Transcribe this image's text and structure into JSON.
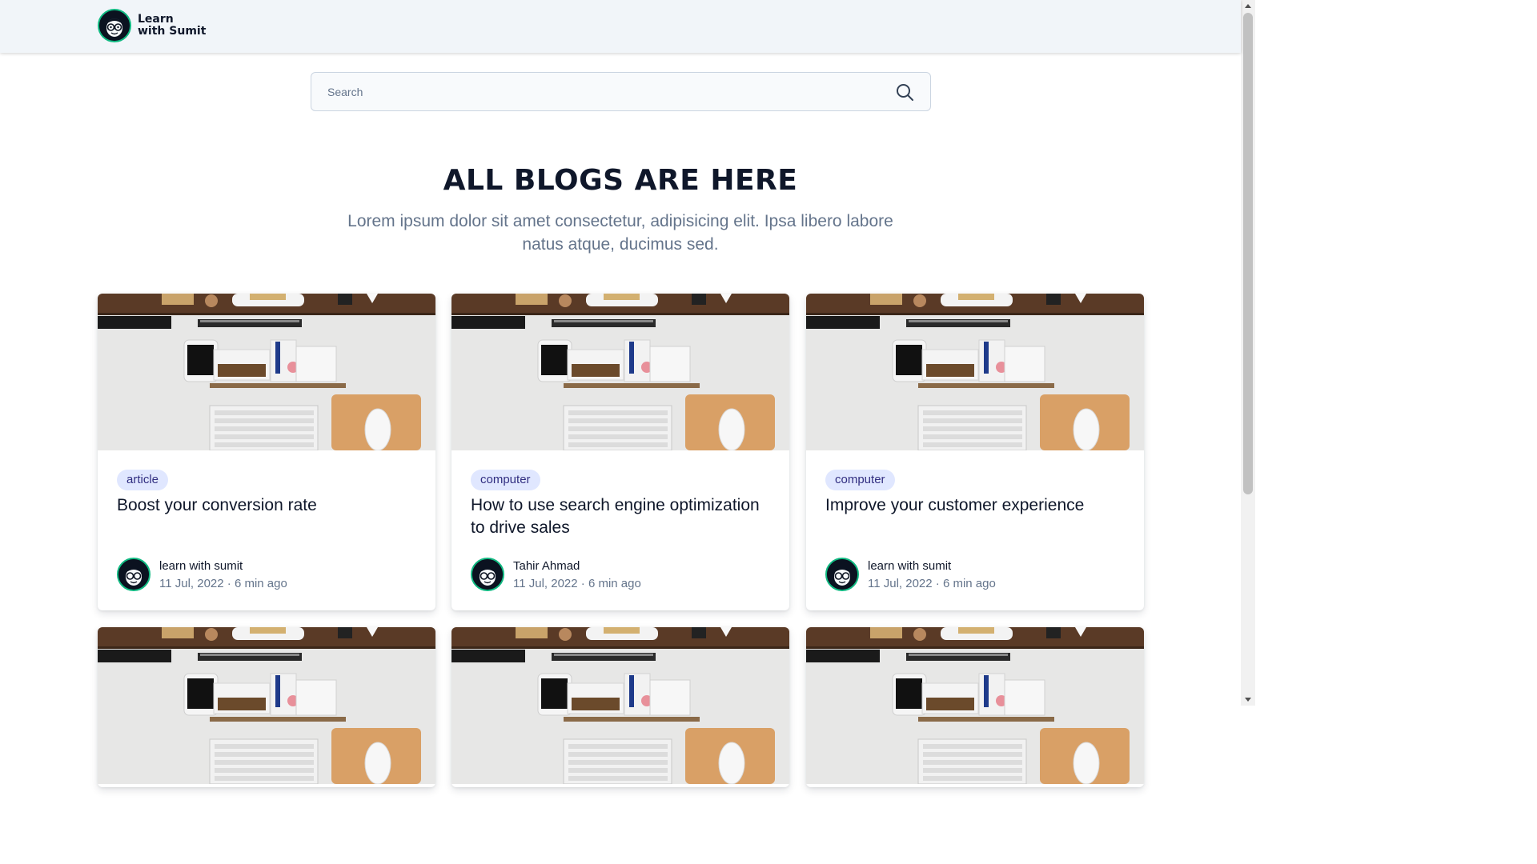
{
  "header": {
    "brand_line1": "Learn",
    "brand_line2": "with Sumit",
    "logo_icon": "face-with-glasses-icon"
  },
  "search": {
    "placeholder": "Search",
    "value": "",
    "icon": "search-icon"
  },
  "hero": {
    "title": "ALL BLOGS ARE HERE",
    "subtitle": "Lorem ipsum dolor sit amet consectetur, adipisicing elit. Ipsa libero labore natus atque, ducimus sed."
  },
  "colors": {
    "tag_bg": "#e0e7ff",
    "tag_text": "#312e81",
    "accent_ring": "#10b981",
    "navbar_bg": "#f1f5f9"
  },
  "posts": [
    {
      "tag": "article",
      "title": "Boost your conversion rate",
      "author": "learn with sumit",
      "meta": "11 Jul, 2022 · 6 min ago"
    },
    {
      "tag": "computer",
      "title": "How to use search engine optimization to drive sales",
      "author": "Tahir Ahmad",
      "meta": "11 Jul, 2022 · 6 min ago"
    },
    {
      "tag": "computer",
      "title": "Improve your customer experience",
      "author": "learn with sumit",
      "meta": "11 Jul, 2022 · 6 min ago"
    }
  ]
}
